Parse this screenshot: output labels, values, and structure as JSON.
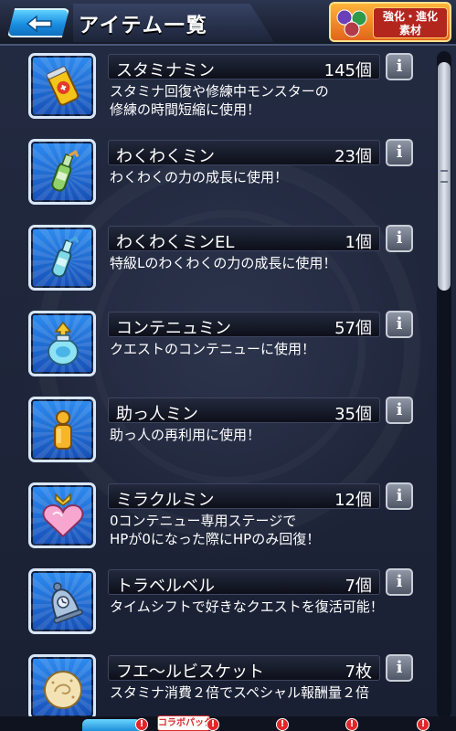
{
  "header": {
    "title": "アイテム一覧",
    "evo_button_label_line1": "強化・進化",
    "evo_button_label_line2": "素材"
  },
  "items": [
    {
      "name": "スタミナミン",
      "count": "145個",
      "desc": "スタミナ回復や修練中モンスターの\n修練の時間短縮に使用！",
      "icon": "stamina-can-icon"
    },
    {
      "name": "わくわくミン",
      "count": "23個",
      "desc": "わくわくの力の成長に使用！",
      "icon": "wakuwaku-bottle-icon"
    },
    {
      "name": "わくわくミンEL",
      "count": "1個",
      "desc": "特級Lのわくわくの力の成長に使用！",
      "icon": "wakuwaku-el-bottle-icon"
    },
    {
      "name": "コンテニュミン",
      "count": "57個",
      "desc": "クエストのコンテニューに使用！",
      "icon": "continue-jar-icon"
    },
    {
      "name": "助っ人ミン",
      "count": "35個",
      "desc": "助っ人の再利用に使用！",
      "icon": "helper-figure-icon"
    },
    {
      "name": "ミラクルミン",
      "count": "12個",
      "desc": "0コンテニュー専用ステージで\nHPが0になった際にHPのみ回復！",
      "icon": "miracle-heart-bottle-icon"
    },
    {
      "name": "トラベルベル",
      "count": "7個",
      "desc": "タイムシフトで好きなクエストを復活可能！",
      "icon": "travel-bell-icon"
    },
    {
      "name": "フエ～ルビスケット",
      "count": "7枚",
      "desc": "スタミナ消費２倍でスペシャル報酬量２倍",
      "icon": "biscuit-icon"
    }
  ],
  "info_label": "i",
  "bottom": {
    "collab_tag": "コラボパック",
    "badge": "!"
  },
  "colors": {
    "background": "#1b2236",
    "icon_tile": "#2e8cf0",
    "back_button": "#1a8ee0",
    "badge": "#e4262a"
  }
}
